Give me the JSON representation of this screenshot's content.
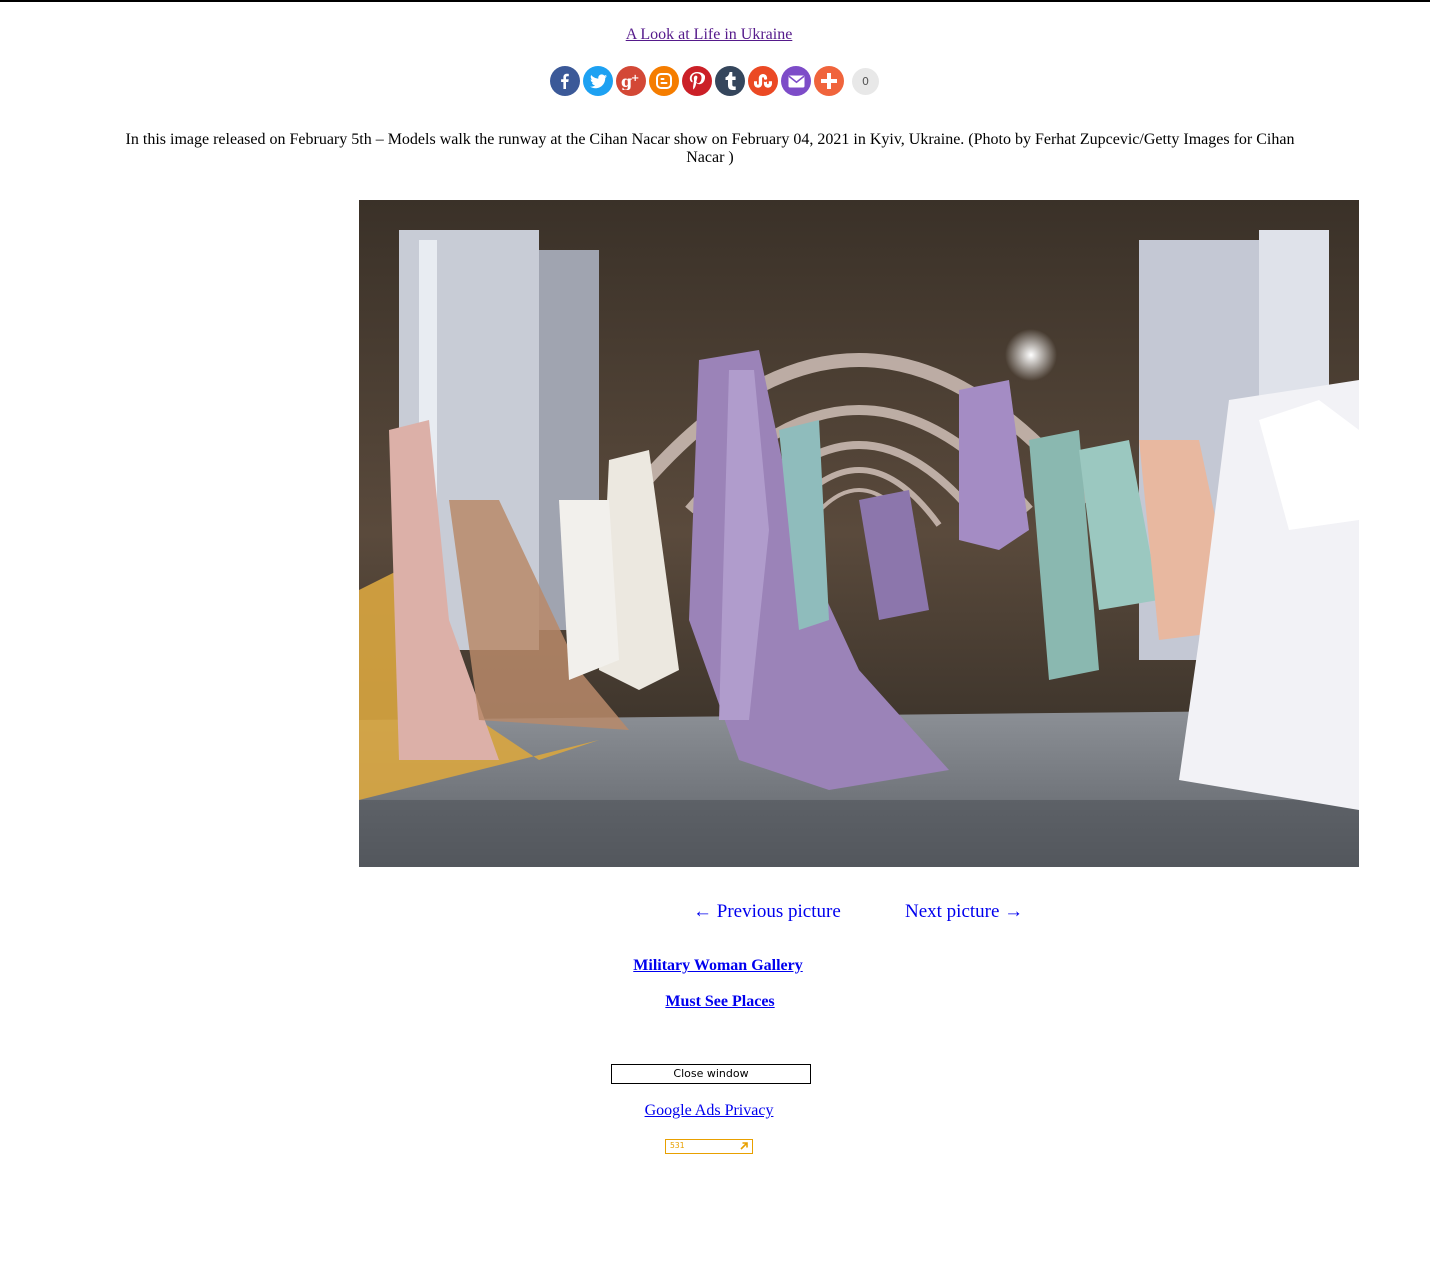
{
  "header": {
    "title_link": "A Look at Life in Ukraine"
  },
  "share": {
    "buttons": [
      {
        "name": "facebook",
        "color": "#3b5998",
        "icon": "facebook-icon"
      },
      {
        "name": "twitter",
        "color": "#1da1f2",
        "icon": "twitter-icon"
      },
      {
        "name": "google-plus",
        "color": "#d34836",
        "icon": "google-plus-icon"
      },
      {
        "name": "blogger",
        "color": "#f57d00",
        "icon": "blogger-icon"
      },
      {
        "name": "pinterest",
        "color": "#cb2027",
        "icon": "pinterest-icon"
      },
      {
        "name": "tumblr",
        "color": "#35465c",
        "icon": "tumblr-icon"
      },
      {
        "name": "stumbleupon",
        "color": "#eb4924",
        "icon": "stumbleupon-icon"
      },
      {
        "name": "email",
        "color": "#7d4cc8",
        "icon": "email-icon"
      },
      {
        "name": "more",
        "color": "#f0643c",
        "icon": "plus-icon"
      }
    ],
    "count": "0"
  },
  "caption": "In this image released on February 5th – Models walk the runway at the Cihan Nacar show on February 04, 2021 in Kyiv, Ukraine. (Photo by Ferhat Zupcevic/Getty Images for Cihan Nacar )",
  "navigation": {
    "previous": "← Previous picture",
    "next": "Next picture →"
  },
  "gallery_links": [
    "Military Woman Gallery",
    "Must See Places"
  ],
  "close_button": "Close window",
  "ads_privacy": "Google Ads Privacy",
  "counter": {
    "value": "531",
    "color": "#e8a000"
  }
}
